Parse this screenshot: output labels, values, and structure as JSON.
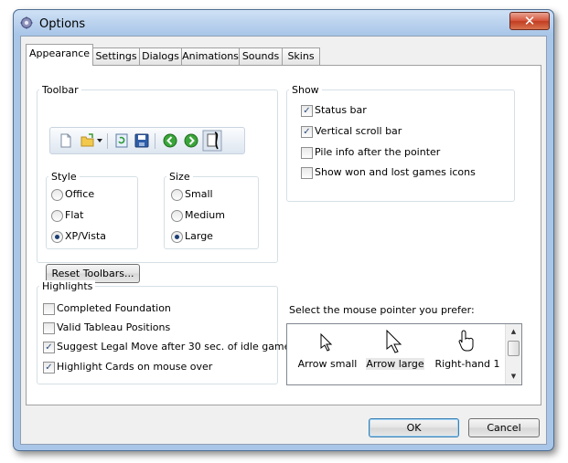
{
  "window": {
    "title": "Options",
    "close_glyph": "✕",
    "app_icon": "gear-icon"
  },
  "tabs": [
    {
      "label": "Appearance",
      "active": true
    },
    {
      "label": "Settings",
      "active": false
    },
    {
      "label": "Dialogs",
      "active": false
    },
    {
      "label": "Animations",
      "active": false
    },
    {
      "label": "Sounds",
      "active": false
    },
    {
      "label": "Skins",
      "active": false
    }
  ],
  "toolbar_group": {
    "label": "Toolbar",
    "icons": [
      "new-document-icon",
      "open-folder-icon",
      "dropdown-arrow-icon",
      "refresh-icon",
      "save-icon",
      "back-arrow-icon",
      "forward-arrow-icon",
      "solitaire-cards-icon"
    ],
    "style": {
      "label": "Style",
      "options": [
        {
          "label": "Office",
          "selected": false
        },
        {
          "label": "Flat",
          "selected": false
        },
        {
          "label": "XP/Vista",
          "selected": true
        }
      ]
    },
    "size": {
      "label": "Size",
      "options": [
        {
          "label": "Small",
          "selected": false
        },
        {
          "label": "Medium",
          "selected": false
        },
        {
          "label": "Large",
          "selected": true
        }
      ]
    },
    "reset_button": "Reset Toolbars..."
  },
  "show_group": {
    "label": "Show",
    "items": [
      {
        "label": "Status bar",
        "checked": true
      },
      {
        "label": "Vertical scroll bar",
        "checked": true
      },
      {
        "label": "Pile info after the pointer",
        "checked": false
      },
      {
        "label": "Show won and lost games icons",
        "checked": false
      }
    ]
  },
  "highlights_group": {
    "label": "Highlights",
    "items": [
      {
        "label": "Completed Foundation",
        "checked": false
      },
      {
        "label": "Valid Tableau Positions",
        "checked": false
      },
      {
        "label": "Suggest Legal Move after 30 sec. of idle game",
        "checked": true
      },
      {
        "label": "Highlight Cards on mouse over",
        "checked": true
      }
    ]
  },
  "pointer": {
    "prompt": "Select the mouse pointer you prefer:",
    "options": [
      {
        "label": "Arrow small",
        "icon": "arrow-small-pointer-icon",
        "selected": false
      },
      {
        "label": "Arrow large",
        "icon": "arrow-large-pointer-icon",
        "selected": true
      },
      {
        "label": "Right-hand 1",
        "icon": "right-hand-pointer-icon",
        "selected": false
      }
    ],
    "scroll_up": "▲",
    "scroll_down": "▼"
  },
  "buttons": {
    "ok": "OK",
    "cancel": "Cancel"
  },
  "colors": {
    "accent": "#3c7fb1",
    "selected_item_bg": "#e8e8e8"
  },
  "check_mark": "✓"
}
